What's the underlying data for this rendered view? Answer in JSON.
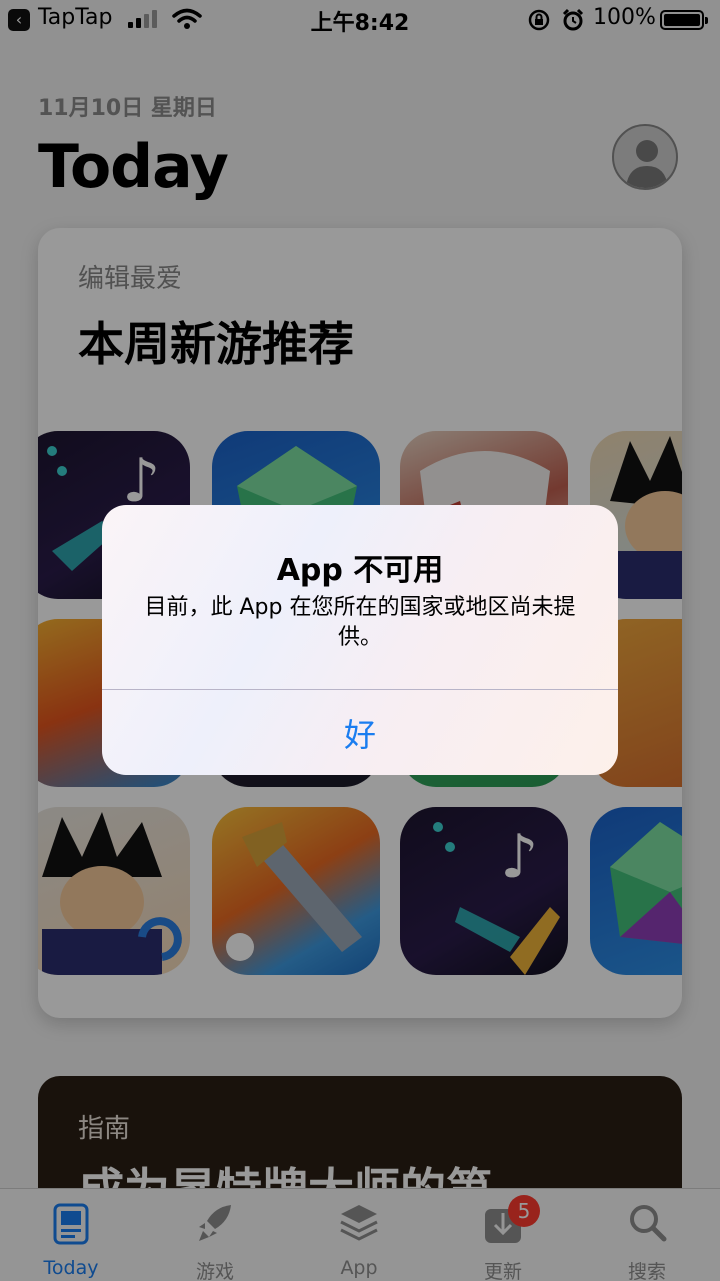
{
  "status_bar": {
    "back_app": "TapTap",
    "time": "上午8:42",
    "battery": "100%"
  },
  "header": {
    "date": "11月10日 星期日",
    "title": "Today"
  },
  "featured_card": {
    "kicker": "编辑最爱",
    "title": "本周新游推荐"
  },
  "guide_card": {
    "kicker": "指南",
    "title": "成为昇特牌大师的第"
  },
  "tab_bar": {
    "tabs": [
      {
        "label": "Today",
        "icon": "today-icon"
      },
      {
        "label": "游戏",
        "icon": "rocket-icon"
      },
      {
        "label": "App",
        "icon": "app-stack-icon"
      },
      {
        "label": "更新",
        "icon": "download-icon",
        "badge": "5"
      },
      {
        "label": "搜索",
        "icon": "search-icon"
      }
    ]
  },
  "alert": {
    "title": "App 不可用",
    "message": "目前，此 App 在您所在的国家或地区尚未提供。",
    "button": "好"
  },
  "colors": {
    "accent": "#1a7df0",
    "badge": "#ff3b30"
  }
}
